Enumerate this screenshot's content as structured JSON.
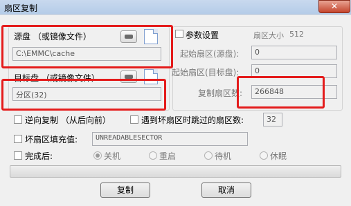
{
  "window": {
    "title": "扇区复制",
    "close_symbol": "✕"
  },
  "source": {
    "label": "源盘 （或镜像文件）",
    "path": "C:\\EMMC\\cache"
  },
  "target": {
    "label": "目标盘 （或镜像文件）",
    "value": "分区(32)"
  },
  "params": {
    "checkbox_label": "参数设置",
    "sector_size_label": "扇区大小",
    "sector_size_value": "512",
    "start_source_label": "起始扇区(源盘):",
    "start_source_value": "0",
    "start_target_label": "起始扇区(目标盘):",
    "start_target_value": "0",
    "copy_count_label": "复制扇区数:",
    "copy_count_value": "266848"
  },
  "options": {
    "reverse_copy": "逆向复制 （从后向前）",
    "skip_bad_label": "遇到坏扇区时跳过的扇区数:",
    "skip_bad_value": "32",
    "fill_bad_label": "坏扇区填充值:",
    "fill_bad_value": "UNREADABLESECTOR",
    "after_done_label": "完成后:",
    "after_done_options": [
      "关机",
      "重启",
      "待机",
      "休眠"
    ],
    "after_done_selected": "关机"
  },
  "buttons": {
    "copy": "复制",
    "cancel": "取消"
  },
  "progress": {
    "fraction": 0
  },
  "icons": {
    "disk": "disk-icon",
    "browse": "file-icon"
  },
  "colors": {
    "highlight_box": "#e41b1b",
    "titlebar": "#b5cce8",
    "close": "#c5452d"
  }
}
